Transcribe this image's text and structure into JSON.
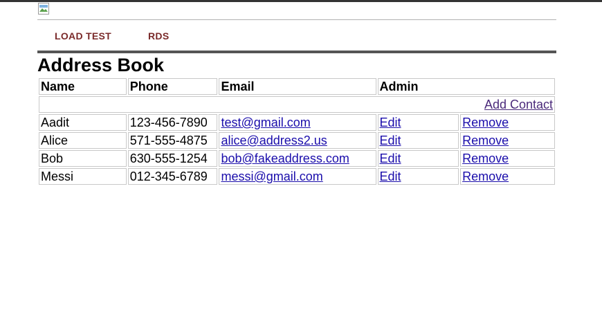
{
  "header": {
    "logo_alt": ""
  },
  "nav": {
    "items": [
      {
        "label": "LOAD TEST"
      },
      {
        "label": "RDS"
      }
    ]
  },
  "page": {
    "title": "Address Book"
  },
  "table": {
    "columns": [
      "Name",
      "Phone",
      "Email",
      "Admin"
    ],
    "add_contact_label": "Add Contact",
    "edit_label": "Edit",
    "remove_label": "Remove",
    "rows": [
      {
        "name": "Aadit",
        "phone": "123-456-7890",
        "email": "test@gmail.com"
      },
      {
        "name": "Alice",
        "phone": "571-555-4875",
        "email": "alice@address2.us"
      },
      {
        "name": "Bob",
        "phone": "630-555-1254",
        "email": "bob@fakeaddress.com"
      },
      {
        "name": "Messi",
        "phone": "012-345-6789",
        "email": "messi@gmail.com"
      }
    ]
  },
  "colors": {
    "nav_link": "#7a2a2a",
    "link": "#1a0dab",
    "visited_link": "#4b2a7b"
  }
}
